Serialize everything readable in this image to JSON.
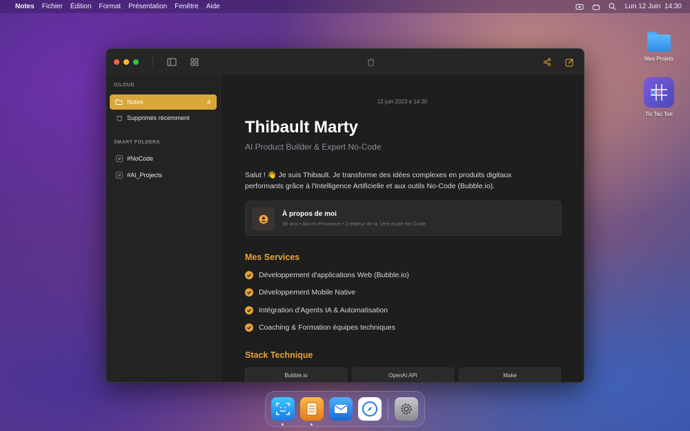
{
  "menubar": {
    "app_name": "Notes",
    "items": [
      "Fichier",
      "Édition",
      "Format",
      "Présentation",
      "Fenêtre",
      "Aide"
    ],
    "clock": "Lun 12 Juin  14:30"
  },
  "desktop": {
    "folder_label": "Mes Projets",
    "app_label": "Tic Tac Toe"
  },
  "sidebar": {
    "icloud_header": "ICLOUD",
    "notes_label": "Notes",
    "notes_count": "4",
    "deleted_label": "Supprimés récemment",
    "smart_header": "SMART FOLDERS",
    "tag1_label": "#NoCode",
    "tag2_label": "#AI_Projects"
  },
  "note": {
    "date": "12 juin 2023 à 14:30",
    "title": "Thibault Marty",
    "subtitle": "AI Product Builder & Expert No-Code",
    "intro": "Salut ! 👋 Je suis Thibault. Je transforme des idées complexes en produits digitaux performants grâce à l'Intelligence Artificielle et aux outils No-Code (Bubble.io).",
    "about_title": "À propos de moi",
    "about_meta": "36 ans • Aix-en-Provence • Créateur de la 1ère école No-Code",
    "services_title": "Mes Services",
    "services": [
      "Développement d'applications Web (Bubble.io)",
      "Développement Mobile Native",
      "Intégration d'Agents IA & Automatisation",
      "Coaching & Formation équipes techniques"
    ],
    "stack_title": "Stack Technique",
    "stack": [
      "Bubble.io",
      "OpenAI API",
      "Make"
    ]
  },
  "colors": {
    "accent": "#e6a33a",
    "sidebar_active": "#d9a63a"
  }
}
